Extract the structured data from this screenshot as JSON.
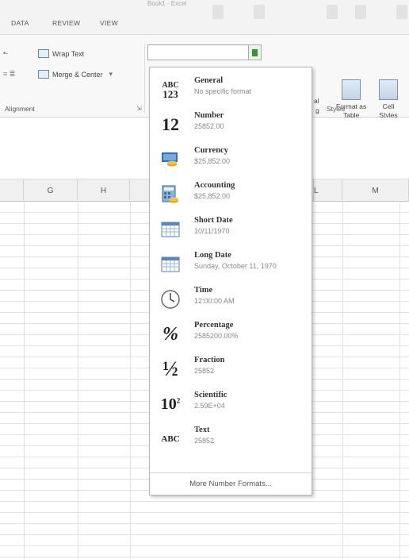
{
  "ribbon": {
    "tabs": [
      "DATA",
      "REVIEW",
      "VIEW"
    ],
    "doc_title": "Book1 - Excel",
    "wrap_text": "Wrap Text",
    "merge_center": "Merge & Center",
    "alignment_label": "Alignment",
    "styles_label": "Styles",
    "conditional_label": "al",
    "conditional_label2": "g",
    "format_as_table": [
      "Format as",
      "Table"
    ],
    "cell_styles": [
      "Cell",
      "Styles"
    ]
  },
  "columns": [
    "G",
    "H",
    "L",
    "M"
  ],
  "dropdown": {
    "items": [
      {
        "name": "General",
        "sample": "No specific format",
        "icon": "general-icon"
      },
      {
        "name": "Number",
        "sample": "25852.00",
        "icon": "number-icon"
      },
      {
        "name": "Currency",
        "sample": "$25,852.00",
        "icon": "currency-icon"
      },
      {
        "name": "Accounting",
        "sample": "$25,852.00",
        "icon": "accounting-icon"
      },
      {
        "name": "Short Date",
        "sample": "10/11/1970",
        "icon": "calendar-icon"
      },
      {
        "name": "Long Date",
        "sample": "Sunday, October 11, 1970",
        "icon": "calendar-icon"
      },
      {
        "name": "Time",
        "sample": "12:00:00 AM",
        "icon": "clock-icon"
      },
      {
        "name": "Percentage",
        "sample": "2585200.00%",
        "icon": "percent-icon"
      },
      {
        "name": "Fraction",
        "sample": "25852",
        "icon": "fraction-icon"
      },
      {
        "name": "Scientific",
        "sample": "2.59E+04",
        "icon": "scientific-icon"
      },
      {
        "name": "Text",
        "sample": "25852",
        "icon": "text-icon"
      }
    ],
    "more": "More Number Formats..."
  },
  "icon_text": {
    "general_top": "ABC",
    "general_bottom": "123",
    "number": "12",
    "percent": "%",
    "fraction": "½",
    "scientific_base": "10",
    "scientific_exp": "2",
    "text": "ABC"
  }
}
